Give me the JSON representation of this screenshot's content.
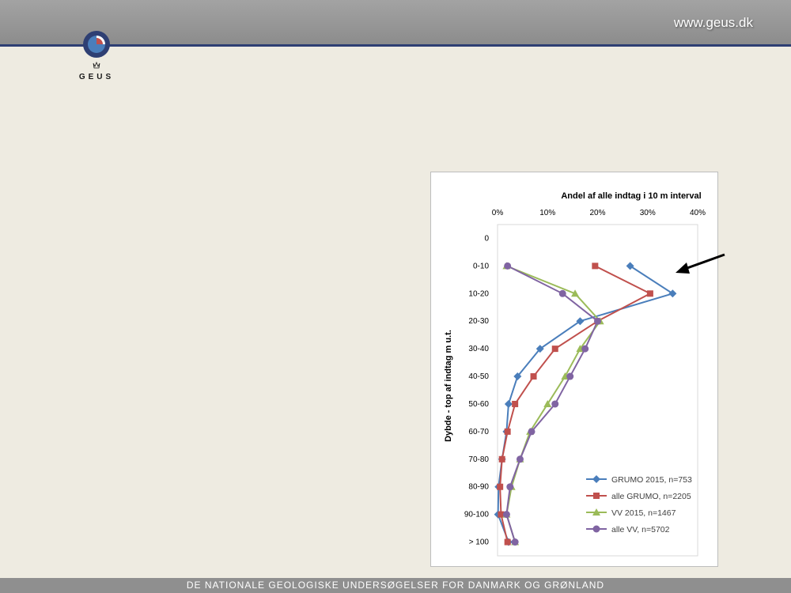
{
  "header": {
    "url": "www.geus.dk"
  },
  "logo": {
    "text": "GEUS"
  },
  "footer": {
    "text": "DE NATIONALE GEOLOGISKE UNDERSØGELSER FOR DANMARK OG GRØNLAND"
  },
  "chart_data": {
    "type": "line",
    "title": "Andel af alle indtag i 10 m interval",
    "ylabel": "Dybde - top af indtag m u.t.",
    "xlabel": "",
    "x_ticks": [
      "0%",
      "10%",
      "20%",
      "30%",
      "40%"
    ],
    "xlim": [
      0,
      40
    ],
    "x_unit": "percent",
    "y_ticks": [
      "0",
      "0-10",
      "10-20",
      "20-30",
      "30-40",
      "40-50",
      "50-60",
      "60-70",
      "70-80",
      "80-90",
      "90-100",
      "> 100"
    ],
    "categories": [
      "0-10",
      "10-20",
      "20-30",
      "30-40",
      "40-50",
      "50-60",
      "60-70",
      "70-80",
      "80-90",
      "90-100",
      "> 100"
    ],
    "legend_position": "bottom-right",
    "series": [
      {
        "name": "GRUMO 2015, n=753",
        "color": "#4a7ebb",
        "marker": "diamond",
        "values": [
          26.5,
          35.0,
          16.5,
          8.5,
          4.0,
          2.2,
          1.8,
          0.9,
          0.2,
          0.1,
          2.2
        ]
      },
      {
        "name": "alle GRUMO, n=2205",
        "color": "#c0504d",
        "marker": "square",
        "values": [
          19.5,
          30.5,
          20.0,
          11.5,
          7.2,
          3.5,
          2.0,
          0.9,
          0.5,
          0.7,
          2.0
        ]
      },
      {
        "name": "VV 2015, n=1467",
        "color": "#9bbb59",
        "marker": "triangle",
        "values": [
          1.8,
          15.5,
          20.5,
          16.5,
          13.5,
          10.0,
          6.5,
          4.5,
          2.8,
          1.8,
          3.5
        ]
      },
      {
        "name": "alle VV, n=5702",
        "color": "#8064a2",
        "marker": "circle",
        "values": [
          2.0,
          13.0,
          20.0,
          17.5,
          14.5,
          11.5,
          6.8,
          4.5,
          2.5,
          1.8,
          3.5
        ]
      }
    ]
  }
}
